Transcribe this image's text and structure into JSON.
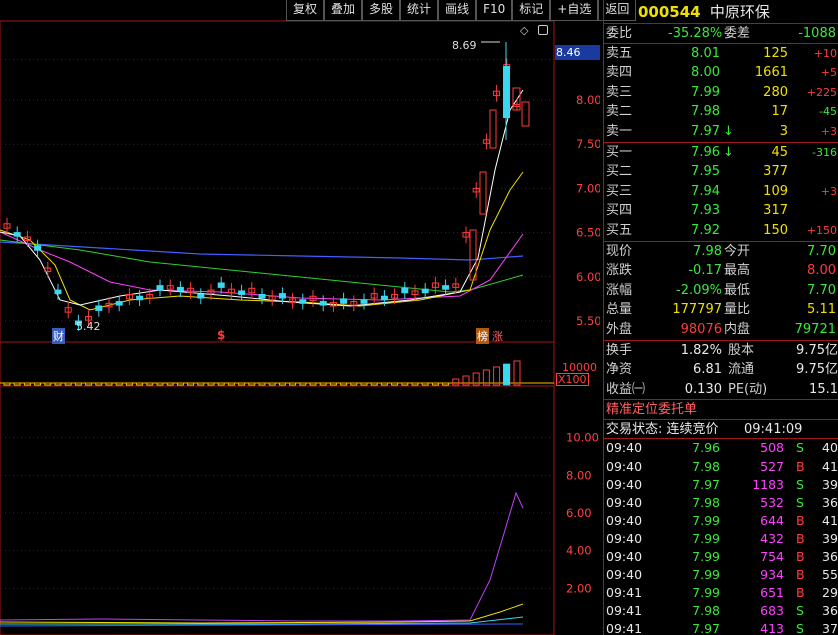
{
  "toolbar": [
    "复权",
    "叠加",
    "多股",
    "统计",
    "画线",
    "F10",
    "标记",
    "+自选",
    "返回"
  ],
  "stock": {
    "code": "000544",
    "name": "中原环保"
  },
  "weibi": {
    "label1": "委比",
    "value1": "-35.28%",
    "label2": "委差",
    "value2": "-1088"
  },
  "asks": [
    {
      "label": "卖五",
      "price": "8.01",
      "vol": "125",
      "chg": "+10"
    },
    {
      "label": "卖四",
      "price": "8.00",
      "vol": "1661",
      "chg": "+5"
    },
    {
      "label": "卖三",
      "price": "7.99",
      "vol": "280",
      "chg": "+225"
    },
    {
      "label": "卖二",
      "price": "7.98",
      "vol": "17",
      "chg": "-45"
    },
    {
      "label": "卖一",
      "price": "7.97",
      "vol": "3",
      "chg": "+3",
      "arrow": "↓"
    }
  ],
  "bids": [
    {
      "label": "买一",
      "price": "7.96",
      "vol": "45",
      "chg": "-316",
      "arrow": "↓"
    },
    {
      "label": "买二",
      "price": "7.95",
      "vol": "377",
      "chg": ""
    },
    {
      "label": "买三",
      "price": "7.94",
      "vol": "109",
      "chg": "+3"
    },
    {
      "label": "买四",
      "price": "7.93",
      "vol": "317",
      "chg": ""
    },
    {
      "label": "买五",
      "price": "7.92",
      "vol": "150",
      "chg": "+150"
    }
  ],
  "stats": [
    {
      "l1": "现价",
      "v1": "7.98",
      "l2": "今开",
      "v2": "7.70"
    },
    {
      "l1": "涨跌",
      "v1": "-0.17",
      "l2": "最高",
      "v2": "8.00"
    },
    {
      "l1": "涨幅",
      "v1": "-2.09%",
      "l2": "最低",
      "v2": "7.70"
    },
    {
      "l1": "总量",
      "v1": "177797",
      "l2": "量比",
      "v2": "5.11"
    },
    {
      "l1": "外盘",
      "v1": "98076",
      "l2": "内盘",
      "v2": "79721"
    }
  ],
  "stats2": [
    {
      "l1": "换手",
      "v1": "1.82%",
      "l2": "股本",
      "v2": "9.75亿"
    },
    {
      "l1": "净资",
      "v1": "6.81",
      "l2": "流通",
      "v2": "9.75亿"
    },
    {
      "l1": "收益㈠",
      "v1": "0.130",
      "l2": "PE(动)",
      "v2": "15.1"
    }
  ],
  "order_title": "精准定位委托单",
  "trade_status": "交易状态: 连续竞价",
  "trade_time": "09:41:09",
  "trades": [
    {
      "t": "09:40",
      "p": "7.96",
      "v": "508",
      "s": "S",
      "n": "40"
    },
    {
      "t": "09:40",
      "p": "7.98",
      "v": "527",
      "s": "B",
      "n": "41"
    },
    {
      "t": "09:40",
      "p": "7.97",
      "v": "1183",
      "s": "S",
      "n": "39"
    },
    {
      "t": "09:40",
      "p": "7.98",
      "v": "532",
      "s": "S",
      "n": "36"
    },
    {
      "t": "09:40",
      "p": "7.99",
      "v": "644",
      "s": "B",
      "n": "41"
    },
    {
      "t": "09:40",
      "p": "7.99",
      "v": "432",
      "s": "B",
      "n": "39"
    },
    {
      "t": "09:40",
      "p": "7.99",
      "v": "754",
      "s": "B",
      "n": "36"
    },
    {
      "t": "09:40",
      "p": "7.99",
      "v": "934",
      "s": "B",
      "n": "55"
    },
    {
      "t": "09:41",
      "p": "7.99",
      "v": "651",
      "s": "B",
      "n": "29"
    },
    {
      "t": "09:41",
      "p": "7.98",
      "v": "683",
      "s": "S",
      "n": "36"
    },
    {
      "t": "09:41",
      "p": "7.97",
      "v": "413",
      "s": "S",
      "n": "37"
    }
  ],
  "chart": {
    "price_axis": [
      "8.46",
      "8.00",
      "7.50",
      "7.00",
      "6.50",
      "6.00",
      "5.50"
    ],
    "vol_axis": [
      "10000",
      "X100"
    ],
    "ind_axis": [
      "10.00",
      "8.00",
      "6.00",
      "4.00",
      "2.00"
    ],
    "high_label": "8.69",
    "low_label": "5.42",
    "marker_cai": "财",
    "marker_s": "$",
    "marker_bang": "榜",
    "marker_zhang": "涨",
    "diamond": "◇"
  }
}
